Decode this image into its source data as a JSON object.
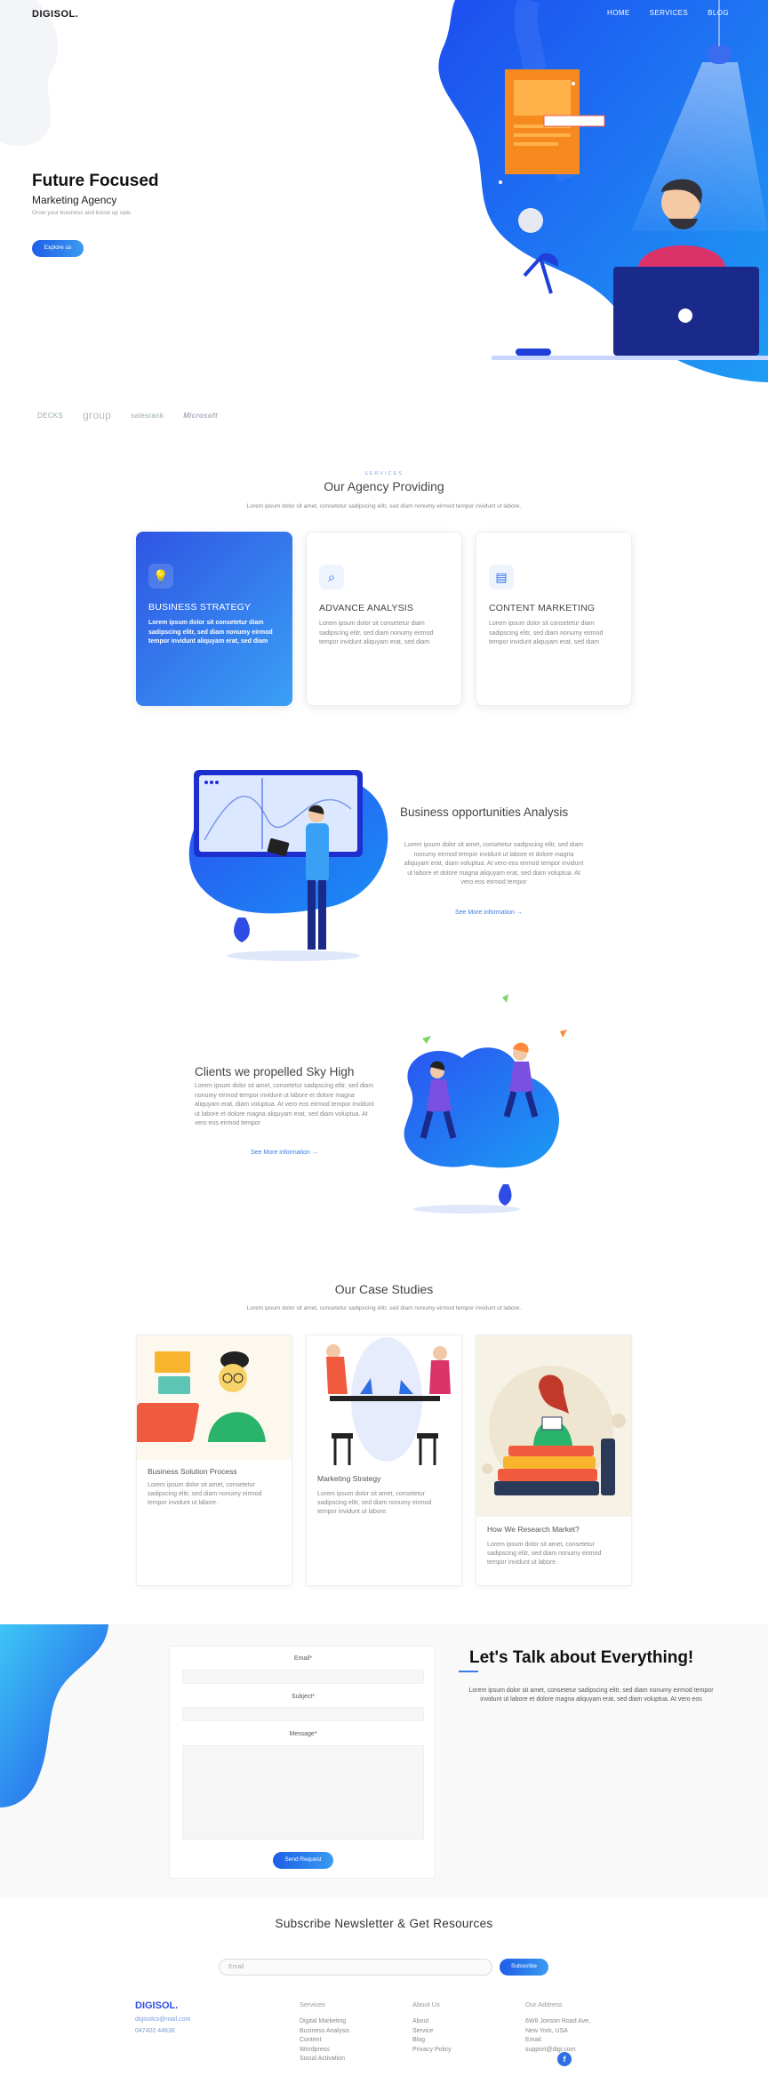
{
  "header": {
    "logo": "DIGISOL.",
    "nav": [
      "HOME",
      "SERVICES",
      "BLOG"
    ]
  },
  "hero": {
    "title": "Future Focused",
    "subtitle": "Marketing Agency",
    "tagline": "Grow your business and boost up sale.",
    "button": "Explore us"
  },
  "brands": [
    "DECKS",
    "group",
    "salesrank",
    "Microsoft"
  ],
  "services": {
    "eyebrow": "SERVICES",
    "title": "Our Agency Providing",
    "lead": "Lorem ipsum dolor sit amet, consetetur sadipscing elitr, sed diam nonumy eirmod tempor invidunt ut labore.",
    "cards": [
      {
        "title": "BUSINESS STRATEGY",
        "desc": "Lorem ipsum dolor sit consetetur diam sadipscing elitr, sed diam nonumy eirmod tempor invidunt aliquyam erat, sed diam",
        "icon": "lightbulb-icon"
      },
      {
        "title": "ADVANCE ANALYSIS",
        "desc": "Lorem ipsum dolor sit consetetur diam sadipscing elitr, sed diam nonumy eirmod tempor invidunt aliquyam erat, sed diam",
        "icon": "magnifier-chart-icon"
      },
      {
        "title": "CONTENT MARKETING",
        "desc": "Lorem ipsum dolor sit consetetur diam sadipscing elitr, sed diam nonumy eirmod tempor invidunt aliquyam erat, sed diam",
        "icon": "document-icon"
      }
    ]
  },
  "feature1": {
    "title": "Business opportunities Analysis",
    "body": "Lorem ipsum dolor sit amet, consetetur sadipscing elitr, sed diam nonumy eirmod tempor invidunt ut labore et dolore magna aliquyam erat, diam voluptua. At vero eos eirmod tempor invidunt ut labore et dolore magna aliquyam erat, sed diam voluptua. At vero eos eirmod tempor",
    "link": "See More information"
  },
  "feature2": {
    "title": "Clients we propelled Sky High",
    "body": "Lorem ipsum dolor sit amet, consetetur sadipscing elitr, sed diam nonumy eirmod tempor invidunt ut labore et dolore magna aliquyam erat, diam voluptua. At vero eos eirmod tempor invidunt ut labore et dolore magna aliquyam erat, sed diam voluptua. At vero eos eirmod tempor",
    "link": "See More information"
  },
  "cases": {
    "title": "Our Case Studies",
    "lead": "Lorem ipsum dolor sit amet, consetetur sadipscing elitr, sed diam nonumy eirmod tempor invidunt ut labore.",
    "items": [
      {
        "title": "Business Solution Process",
        "body": "Lorem ipsum dolor sit amet, consetetur sadipscing elitr, sed diam nonumy eirmod tempor invidunt ut labore."
      },
      {
        "title": "Marketing Strategy",
        "body": "Lorem ipsum dolor sit amet, consetetur sadipscing elitr, sed diam nonumy eirmod tempor invidunt ut labore."
      },
      {
        "title": "How We Research Market?",
        "body": "Lorem ipsum dolor sit amet, consetetur sadipscing elitr, sed diam nonumy eirmod tempor invidunt ut labore."
      }
    ]
  },
  "contact": {
    "email_label": "Email*",
    "subject_label": "Subject*",
    "message_label": "Message*",
    "button": "Send Request",
    "title": "Let's Talk about Everything!",
    "body": "Lorem ipsum dolor sit amet, consetetur sadipscing elitr, sed diam nonumy eirmod tempor invidunt ut labore et dolore magna aliquyam erat, sed diam voluptua. At vero eos"
  },
  "newsletter": {
    "title": "Subscribe Newsletter & Get Resources",
    "placeholder": "Email",
    "button": "Subscribe"
  },
  "footer": {
    "logo": "DIGISOL.",
    "email": "digisolco@mail.com",
    "phone": "047402 44636",
    "services_head": "Services",
    "services": [
      "Digital Marketing",
      "Business Analysis",
      "Content",
      "Wordpress",
      "Social Activation"
    ],
    "about_head": "About Us",
    "about": [
      "About",
      "Service",
      "Blog",
      "Privacy Policy"
    ],
    "address_head": "Our Address",
    "address": [
      "6W8 Jonson Road Ave,",
      "New York, USA",
      "Email:",
      "support@digi.com"
    ],
    "facebook": "f"
  },
  "colors": {
    "primary": "#2f6fe4",
    "accent": "#3aa0f5",
    "orange": "#f7861e"
  }
}
